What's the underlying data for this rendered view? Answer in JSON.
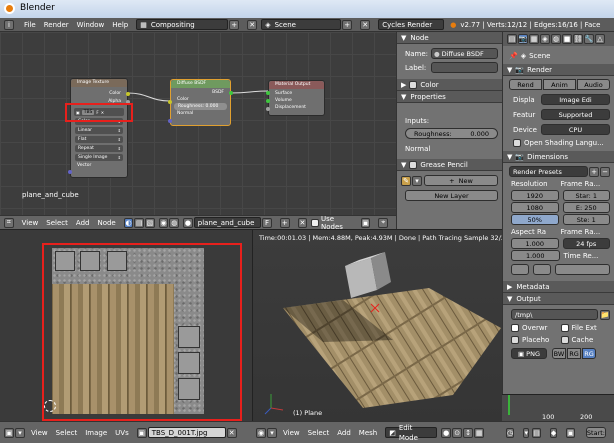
{
  "window": {
    "title": "Blender"
  },
  "menu": {
    "file": "File",
    "render": "Render",
    "window": "Window",
    "help": "Help",
    "screen_layout": "Compositing",
    "scene": "Scene",
    "engine": "Cycles Render",
    "stats": "v2.77 | Verts:12/12 | Edges:16/16 | Face"
  },
  "node_editor": {
    "object_label": "plane_and_cube",
    "image_node": {
      "title": "Image Texture",
      "out_color": "Color",
      "out_alpha": "Alpha",
      "image": "TBS",
      "opts": [
        "Color",
        "Linear",
        "Flat",
        "Repeat",
        "Single Image"
      ],
      "vector": "Vector"
    },
    "bsdf_node": {
      "title": "Diffuse BSDF",
      "out": "BSDF",
      "color": "Color",
      "roughness": "Roughness: 0.000",
      "normal": "Normal"
    },
    "output_node": {
      "title": "Material Output",
      "surface": "Surface",
      "volume": "Volume",
      "displacement": "Displacement"
    },
    "header": {
      "view": "View",
      "select": "Select",
      "add": "Add",
      "node": "Node",
      "material": "plane_and_cube",
      "f": "F",
      "use_nodes": "Use Nodes"
    }
  },
  "node_props": {
    "section_node": "Node",
    "name_label": "Name:",
    "name_value": "Diffuse BSDF",
    "label_label": "Label:",
    "label_value": "",
    "color": "Color",
    "properties": "Properties",
    "inputs": "Inputs:",
    "roughness_label": "Roughness:",
    "roughness_value": "0.000",
    "normal": "Normal",
    "grease_pencil": "Grease Pencil",
    "new_btn": "New",
    "new_layer": "New Layer"
  },
  "render_props": {
    "scene": "Scene",
    "render": "Render",
    "render_btn": "Rend",
    "anim_btn": "Anim",
    "audio_btn": "Audio",
    "display_label": "Displa",
    "display_value": "Image Edi",
    "feature_label": "Featur",
    "feature_value": "Supported",
    "device_label": "Device",
    "device_value": "CPU",
    "osl": "Open Shading Langu...",
    "dimensions": "Dimensions",
    "render_presets": "Render Presets",
    "resolution": "Resolution",
    "frame_range": "Frame Ra...",
    "res_x": "1920",
    "res_y": "1080",
    "res_pct": "50%",
    "start": "Star: 1",
    "end": "E: 250",
    "step": "Ste: 1",
    "aspect": "Aspect Ra",
    "frame_rate": "Frame Ra...",
    "aspect_x": "1.000",
    "aspect_y": "1.000",
    "fps": "24 fps",
    "time_remap": "Time Re...",
    "metadata": "Metadata",
    "output": "Output",
    "output_path": "/tmp\\",
    "overwrite": "Overwr",
    "file_ext": "File Ext",
    "placeholders": "Placeho",
    "cache": "Cache",
    "format": "PNG",
    "bw": "BW",
    "rgb": "RG",
    "rgba": "RG"
  },
  "image_editor": {
    "view": "View",
    "select": "Select",
    "image": "Image",
    "uvs": "UVs",
    "image_name": "TBS_D_001T.jpg"
  },
  "viewport": {
    "status": "Time:00:01.03 | Mem:4.88M, Peak:4.93M | Done | Path Tracing Sample 32/32",
    "object_label": "(1) Plane",
    "view": "View",
    "select": "Select",
    "add": "Add",
    "mesh": "Mesh",
    "mode": "Edit Mode"
  },
  "timeline": {
    "t100": "100",
    "t200": "200",
    "start": "Start:"
  },
  "colors": {
    "highlight": "#e8201c",
    "accent_blue": "#5680c2",
    "node_bg": "#3d3d3d",
    "panel_bg": "#727272"
  }
}
